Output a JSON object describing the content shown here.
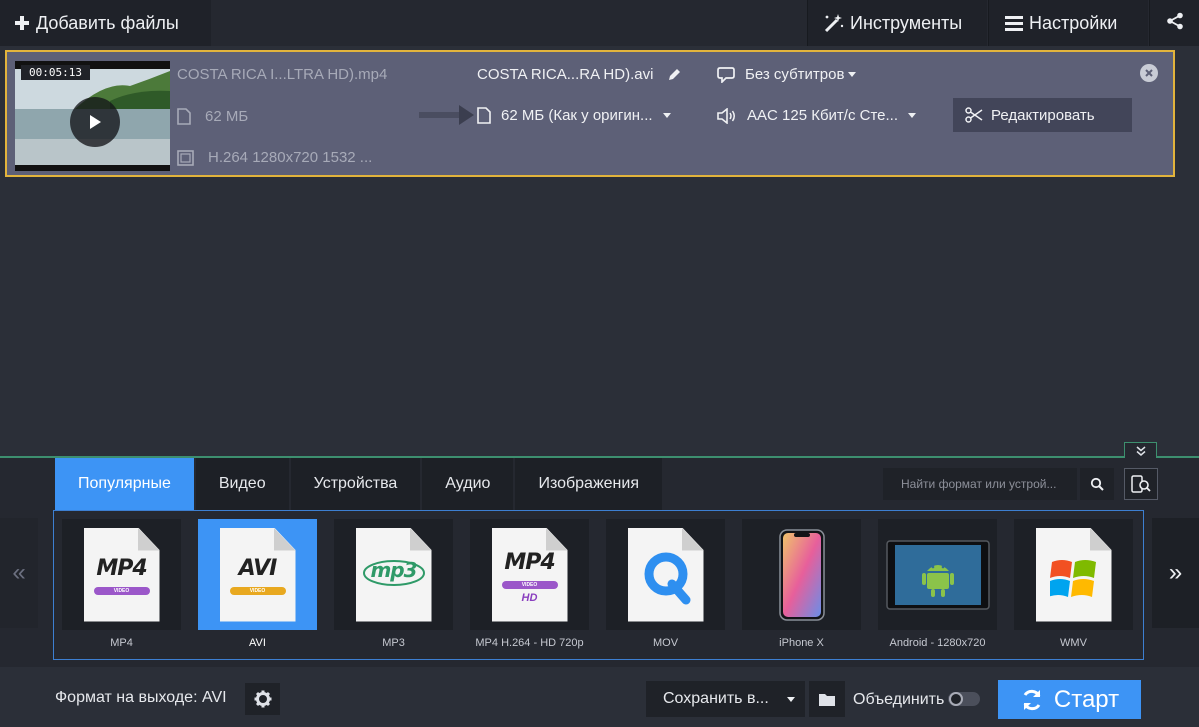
{
  "toolbar": {
    "add_files": "Добавить файлы",
    "tools": "Инструменты",
    "settings": "Настройки"
  },
  "file": {
    "duration": "00:05:13",
    "source_name": "COSTA RICA I...LTRA HD).mp4",
    "source_size": "62 МБ",
    "source_codec": "H.264 1280x720 1532 ...",
    "output_name": "COSTA RICA...RA HD).avi",
    "output_size": "62 МБ (Как у оригин...",
    "subtitles": "Без субтитров",
    "audio": "AAC 125 Кбит/с Сте...",
    "edit_label": "Редактировать"
  },
  "tabs": [
    {
      "label": "Популярные",
      "active": true
    },
    {
      "label": "Видео",
      "active": false
    },
    {
      "label": "Устройства",
      "active": false
    },
    {
      "label": "Аудио",
      "active": false
    },
    {
      "label": "Изображения",
      "active": false
    }
  ],
  "search": {
    "placeholder": "Найти формат или устрой..."
  },
  "nav": {
    "prev": "«",
    "next": "»"
  },
  "formats": [
    {
      "label": "MP4",
      "icon": "mp4-icon"
    },
    {
      "label": "AVI",
      "icon": "avi-icon",
      "active": true
    },
    {
      "label": "MP3",
      "icon": "mp3-icon"
    },
    {
      "label": "MP4 H.264 - HD 720p",
      "icon": "mp4-hd-icon"
    },
    {
      "label": "MOV",
      "icon": "quicktime-icon"
    },
    {
      "label": "iPhone X",
      "icon": "iphone-icon"
    },
    {
      "label": "Android - 1280x720",
      "icon": "android-tablet-icon"
    },
    {
      "label": "WMV",
      "icon": "windows-icon"
    }
  ],
  "format_badges": {
    "mp4": "MP4",
    "avi": "AVI",
    "mp3": "mp3",
    "video": "VIDEO",
    "hd": "HD"
  },
  "footer": {
    "output_format": "Формат на выходе: AVI",
    "save_to": "Сохранить в...",
    "merge": "Объединить",
    "start": "Старт"
  },
  "colors": {
    "accent": "#3d94f5",
    "selection_border": "#e2b43c",
    "panel_border": "#3d8f6f"
  }
}
